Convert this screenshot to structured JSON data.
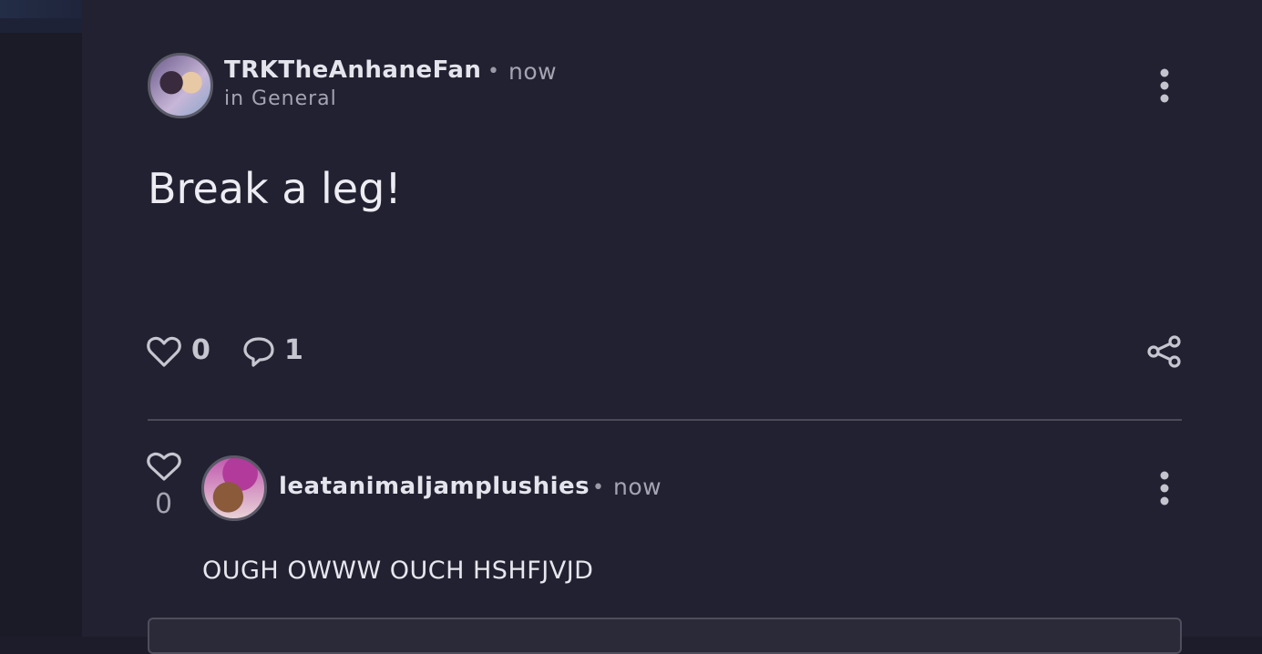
{
  "post": {
    "author": "TRKTheAnhaneFan",
    "separator": "•",
    "time": "now",
    "channel": "in General",
    "body": "Break a leg!",
    "like_count": "0",
    "comment_count": "1",
    "icons": {
      "more": "more-vertical-icon",
      "like": "heart-icon",
      "comment": "speech-bubble-icon",
      "share": "share-icon"
    }
  },
  "comment": {
    "author": "leatanimaljamplushies",
    "separator": "•",
    "time": "now",
    "like_count": "0",
    "body": "OUGH OWWW OUCH HSHFJVJD",
    "icons": {
      "like": "heart-icon",
      "more": "more-vertical-icon"
    }
  },
  "colors": {
    "background": "#212131",
    "text_primary": "#ececf2",
    "text_muted": "#a4a4b2",
    "divider": "#4a4a58"
  }
}
